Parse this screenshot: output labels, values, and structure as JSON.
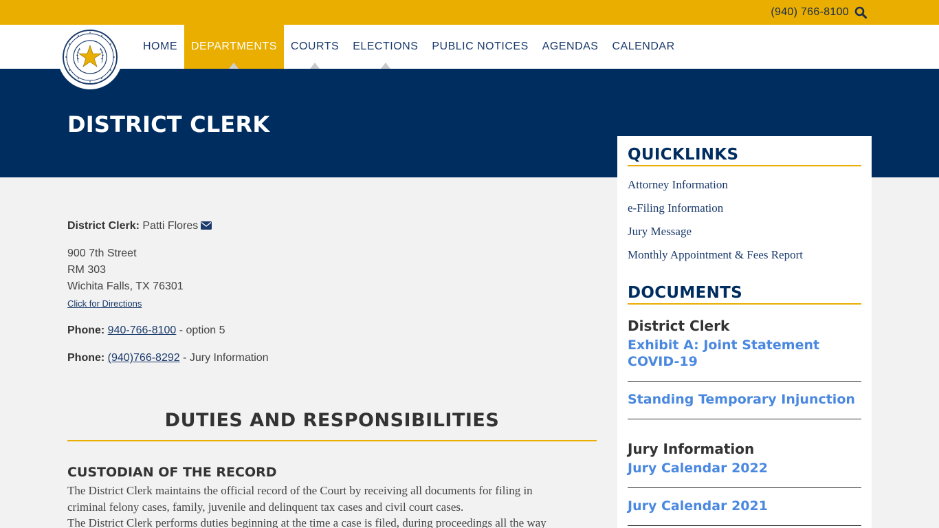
{
  "topbar": {
    "phone": "(940) 766-8100",
    "search_icon": "search-icon"
  },
  "nav": {
    "logo_alt": "County of Wichita Texas seal",
    "items": [
      {
        "label": "HOME",
        "active": false,
        "has_menu": false
      },
      {
        "label": "DEPARTMENTS",
        "active": true,
        "has_menu": true
      },
      {
        "label": "COURTS",
        "active": false,
        "has_menu": true
      },
      {
        "label": "ELECTIONS",
        "active": false,
        "has_menu": true
      },
      {
        "label": "PUBLIC NOTICES",
        "active": false,
        "has_menu": false
      },
      {
        "label": "AGENDAS",
        "active": false,
        "has_menu": false
      },
      {
        "label": "CALENDAR",
        "active": false,
        "has_menu": false
      }
    ]
  },
  "hero": {
    "title": "DISTRICT CLERK"
  },
  "contact": {
    "clerk_label": "District Clerk:",
    "clerk_name": "Patti Flores",
    "address_line1": "900 7th Street",
    "address_line2": "RM 303",
    "address_line3": "Wichita Falls, TX 76301",
    "directions_link": "Click for Directions",
    "phone1_label": "Phone:",
    "phone1_number": "940-766-8100",
    "phone1_note": " - option 5",
    "phone2_label": "Phone:",
    "phone2_number": "(940)766-8292",
    "phone2_note": " - Jury Information"
  },
  "duties": {
    "title": "DUTIES AND RESPONSIBILITIES",
    "section1_title": "CUSTODIAN OF THE RECORD",
    "para1_line1": "The District Clerk maintains the official record of the Court by receiving all documents for filing in",
    "para1_line2": "criminal felony cases, family, juvenile and delinquent tax cases and civil court cases.",
    "para2_line1": "The District Clerk performs duties beginning at the time a case is filed, during proceedings all the way"
  },
  "sidebar": {
    "quicklinks_title": "QUICKLINKS",
    "quicklinks": [
      "Attorney Information",
      "e-Filing Information",
      "Jury Message",
      "Monthly Appointment & Fees Report"
    ],
    "documents_title": "DOCUMENTS",
    "doc_group1": "District Clerk",
    "doc1_line1": "Exhibit A: Joint Statement",
    "doc1_line2": "COVID-19",
    "doc2": "Standing Temporary Injunction",
    "doc_group2": "Jury Information",
    "doc3": "Jury Calendar 2022",
    "doc4": "Jury Calendar 2021"
  },
  "colors": {
    "gold": "#e9ae00",
    "navy": "#002d5f",
    "link_blue": "#4a88e0"
  }
}
